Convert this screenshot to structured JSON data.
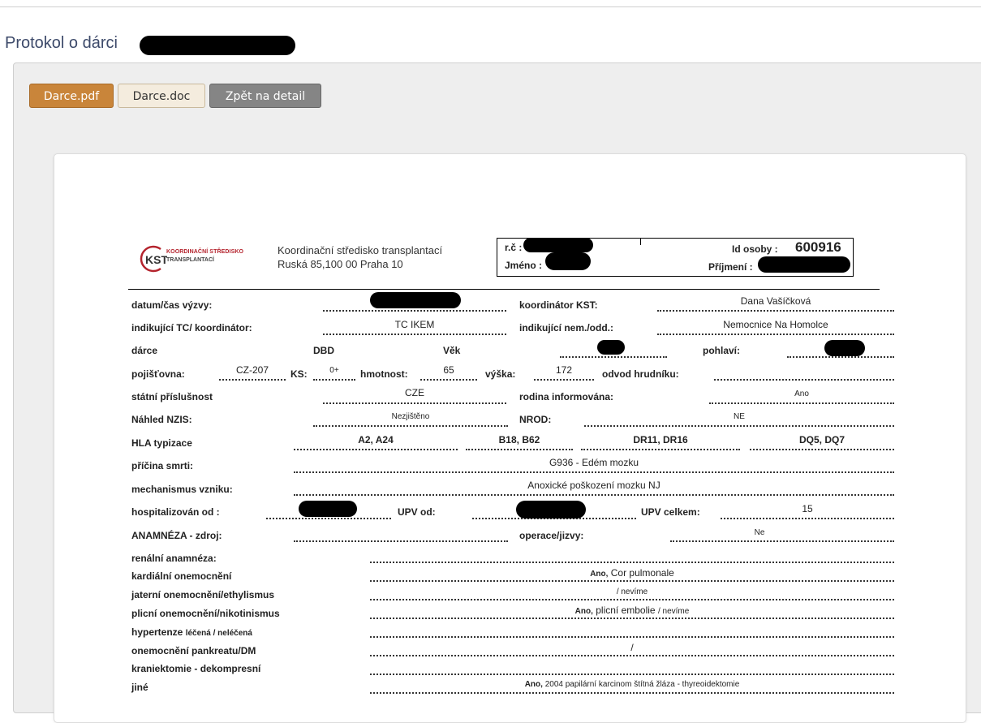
{
  "page": {
    "title": "Protokol o dárci"
  },
  "buttons": {
    "pdf": "Darce.pdf",
    "doc": "Darce.doc",
    "back": "Zpět na detail"
  },
  "header": {
    "logo_line1": "KOORDINAČNÍ STŘEDISKO",
    "logo_line2": "TRANSPLANTACÍ",
    "logo_mark": "KST",
    "org_name": "Koordinační středisko transplantací",
    "org_address": "Ruská 85,100 00 Praha 10",
    "rc_label": "r.č :",
    "jmeno_label": "Jméno :",
    "id_label": "Id osoby :",
    "id_value": "600916",
    "prijmeni_label": "Příjmení :"
  },
  "form": {
    "datum_label": "datum/čas výzvy:",
    "koordinator_label": "koordinátor KST:",
    "koordinator_value": "Dana Vašíčková",
    "indik_tc_label": "indikující TC/ koordinátor:",
    "indik_tc_value": "TC IKEM",
    "indik_nem_label": "indikující nem./odd.:",
    "indik_nem_value": "Nemocnice Na Homolce",
    "darce_label": "dárce",
    "darce_value": "DBD",
    "vek_label": "Věk",
    "pohlavi_label": "pohlaví:",
    "pojistovna_label": "pojišťovna:",
    "pojistovna_value": "CZ-207",
    "ks_label": "KS:",
    "ks_value": "0+",
    "hmotnost_label": "hmotnost:",
    "hmotnost_value": "65",
    "vyska_label": "výška:",
    "vyska_value": "172",
    "odvod_label": "odvod hrudníku:",
    "statni_label": "státní příslušnost",
    "statni_value": "CZE",
    "rodina_label": "rodina informována:",
    "rodina_value": "Ano",
    "nzis_label": "Náhled NZIS:",
    "nzis_value": "Nezjištěno",
    "nrod_label": "NROD:",
    "nrod_value": "NE",
    "hla_label": "HLA typizace",
    "hla_a": "A2, A24",
    "hla_b": "B18, B62",
    "hla_dr": "DR11, DR16",
    "hla_dq": "DQ5, DQ7",
    "pricina_label": "příčina smrti:",
    "pricina_value": "G936 - Edém mozku",
    "mechanismus_label": "mechanismus vzniku:",
    "mechanismus_value": "Anoxické poškození mozku NJ",
    "hosp_label": "hospitalizován od :",
    "upv_od_label": "UPV od:",
    "upv_celkem_label": "UPV celkem:",
    "upv_celkem_value": "15",
    "anamneza_label": "ANAMNÉZA - zdroj:",
    "operace_label": "operace/jizvy:",
    "operace_value": "Ne",
    "renalni_label": "renální anamnéza:",
    "kardialni_label": "kardiální onemocnění",
    "kardialni_prefix": "Ano,",
    "kardialni_value": "Cor pulmonale",
    "jaterni_label": "jaterní onemocnění/ethylismus",
    "jaterni_value": "/ nevíme",
    "plicni_label": "plicní onemocnění/nikotinismus",
    "plicni_prefix": "Ano,",
    "plicni_value": "plicní embolie",
    "plicni_suffix": "/ nevíme",
    "hypertenze_label": "hypertenze",
    "hypertenze_sub": "léčená / neléčená",
    "pankreas_label": "onemocnění pankreatu/DM",
    "pankreas_value": "/",
    "kraniektomie_label": "kraniektomie - dekompresní",
    "jine_label": "jiné",
    "jine_prefix": "Ano,",
    "jine_value": "2004 papilární karcinom štítná žláza - thyreoidektomie"
  }
}
